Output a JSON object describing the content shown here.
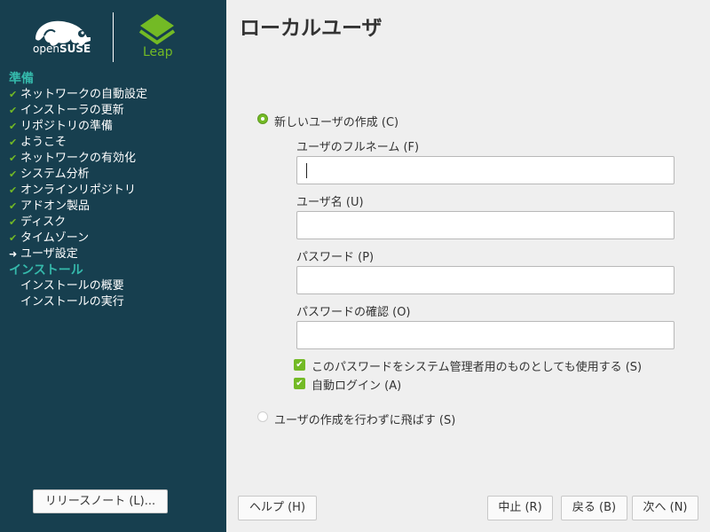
{
  "sidebar": {
    "brand": {
      "opensuse_prefix": "open",
      "opensuse_bold": "SUSE",
      "leap": "Leap"
    },
    "sections": [
      {
        "heading": "準備",
        "items": [
          {
            "label": "ネットワークの自動設定",
            "status": "done"
          },
          {
            "label": "インストーラの更新",
            "status": "done"
          },
          {
            "label": "リポジトリの準備",
            "status": "done"
          },
          {
            "label": "ようこそ",
            "status": "done"
          },
          {
            "label": "ネットワークの有効化",
            "status": "done"
          },
          {
            "label": "システム分析",
            "status": "done"
          },
          {
            "label": "オンラインリポジトリ",
            "status": "done"
          },
          {
            "label": "アドオン製品",
            "status": "done"
          },
          {
            "label": "ディスク",
            "status": "done"
          },
          {
            "label": "タイムゾーン",
            "status": "done"
          },
          {
            "label": "ユーザ設定",
            "status": "current"
          }
        ]
      },
      {
        "heading": "インストール",
        "items": [
          {
            "label": "インストールの概要",
            "status": "pending"
          },
          {
            "label": "インストールの実行",
            "status": "pending"
          }
        ]
      }
    ],
    "release_notes_button": "リリースノート (L)..."
  },
  "main": {
    "title": "ローカルユーザ",
    "create_user_option": "新しいユーザの作成 (C)",
    "fullname_label": "ユーザのフルネーム (F)",
    "fullname_value": "",
    "username_label": "ユーザ名 (U)",
    "username_value": "",
    "password_label": "パスワード (P)",
    "password_value": "",
    "confirm_label": "パスワードの確認 (O)",
    "confirm_value": "",
    "admin_password_checkbox": "このパスワードをシステム管理者用のものとしても使用する (S)",
    "admin_password_checked": true,
    "autologin_checkbox": "自動ログイン (A)",
    "autologin_checked": true,
    "skip_user_option": "ユーザの作成を行わずに飛ばす (S)",
    "selected_option": "create_user"
  },
  "footer": {
    "help": "ヘルプ (H)",
    "abort": "中止 (R)",
    "back": "戻る (B)",
    "next": "次へ (N)"
  },
  "colors": {
    "sidebar_bg": "#173f4f",
    "accent_green": "#73ba25",
    "heading_teal": "#35b9ab",
    "content_bg": "#efefef"
  },
  "icons": {
    "done": "checkmark-icon",
    "current": "arrow-right-icon",
    "brand": "chameleon-logo"
  }
}
